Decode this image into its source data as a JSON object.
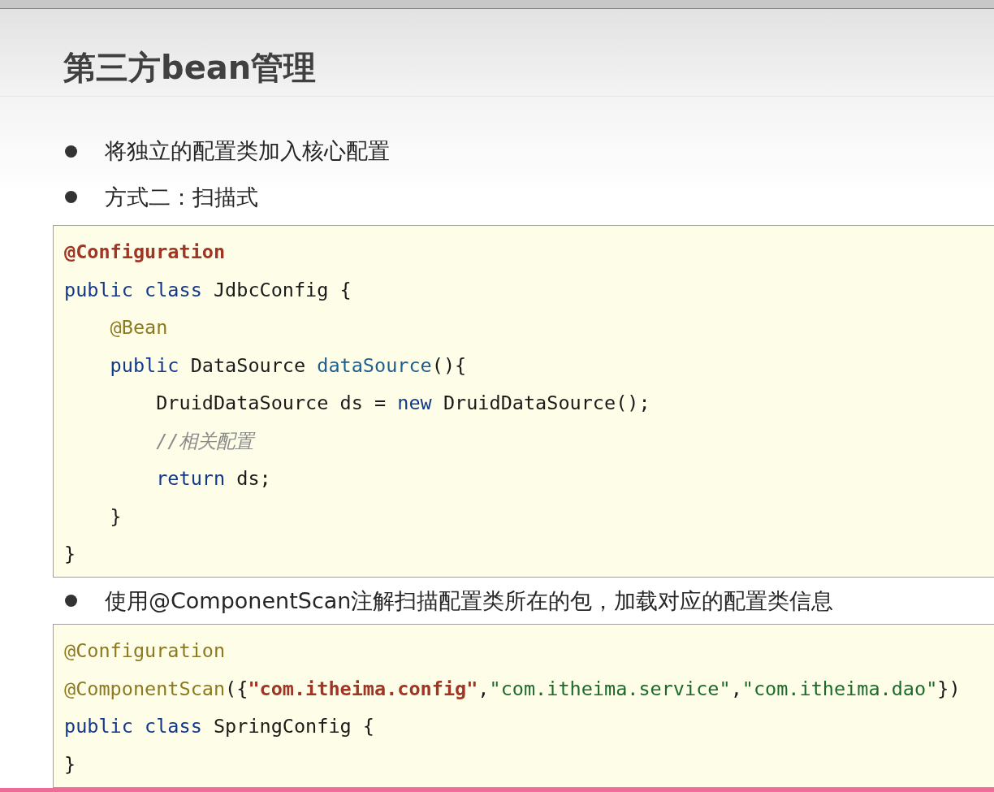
{
  "slide": {
    "title": "第三方bean管理",
    "bullets_top": [
      "将独立的配置类加入核心配置",
      "方式二：扫描式"
    ],
    "code_1": [
      [
        {
          "kind": "annotation-bold",
          "text": "@Configuration"
        }
      ],
      [
        {
          "kind": "keyword",
          "text": "public class "
        },
        {
          "kind": "plain",
          "text": "JdbcConfig {"
        }
      ],
      [
        {
          "kind": "annotation",
          "text": "    @Bean"
        }
      ],
      [
        {
          "kind": "keyword",
          "text": "    public "
        },
        {
          "kind": "plain",
          "text": "DataSource "
        },
        {
          "kind": "method",
          "text": "dataSource"
        },
        {
          "kind": "plain",
          "text": "(){"
        }
      ],
      [
        {
          "kind": "plain",
          "text": "        DruidDataSource ds = "
        },
        {
          "kind": "keyword",
          "text": "new "
        },
        {
          "kind": "plain",
          "text": "DruidDataSource();"
        }
      ],
      [
        {
          "kind": "comment",
          "text": "        //相关配置"
        }
      ],
      [
        {
          "kind": "keyword",
          "text": "        return "
        },
        {
          "kind": "plain",
          "text": "ds;"
        }
      ],
      [
        {
          "kind": "plain",
          "text": "    }"
        }
      ],
      [
        {
          "kind": "plain",
          "text": "}"
        }
      ]
    ],
    "bullet_middle": "使用@ComponentScan注解扫描配置类所在的包，加载对应的配置类信息",
    "code_2": [
      [
        {
          "kind": "annotation",
          "text": "@Configuration"
        }
      ],
      [
        {
          "kind": "annotation",
          "text": "@ComponentScan"
        },
        {
          "kind": "plain",
          "text": "({"
        },
        {
          "kind": "string-bold",
          "text": "\"com.itheima.config\""
        },
        {
          "kind": "plain",
          "text": ","
        },
        {
          "kind": "string",
          "text": "\"com.itheima.service\""
        },
        {
          "kind": "plain",
          "text": ","
        },
        {
          "kind": "string",
          "text": "\"com.itheima.dao\""
        },
        {
          "kind": "plain",
          "text": "})"
        }
      ],
      [
        {
          "kind": "keyword",
          "text": "public class "
        },
        {
          "kind": "plain",
          "text": "SpringConfig {"
        }
      ],
      [
        {
          "kind": "plain",
          "text": "}"
        }
      ]
    ]
  }
}
